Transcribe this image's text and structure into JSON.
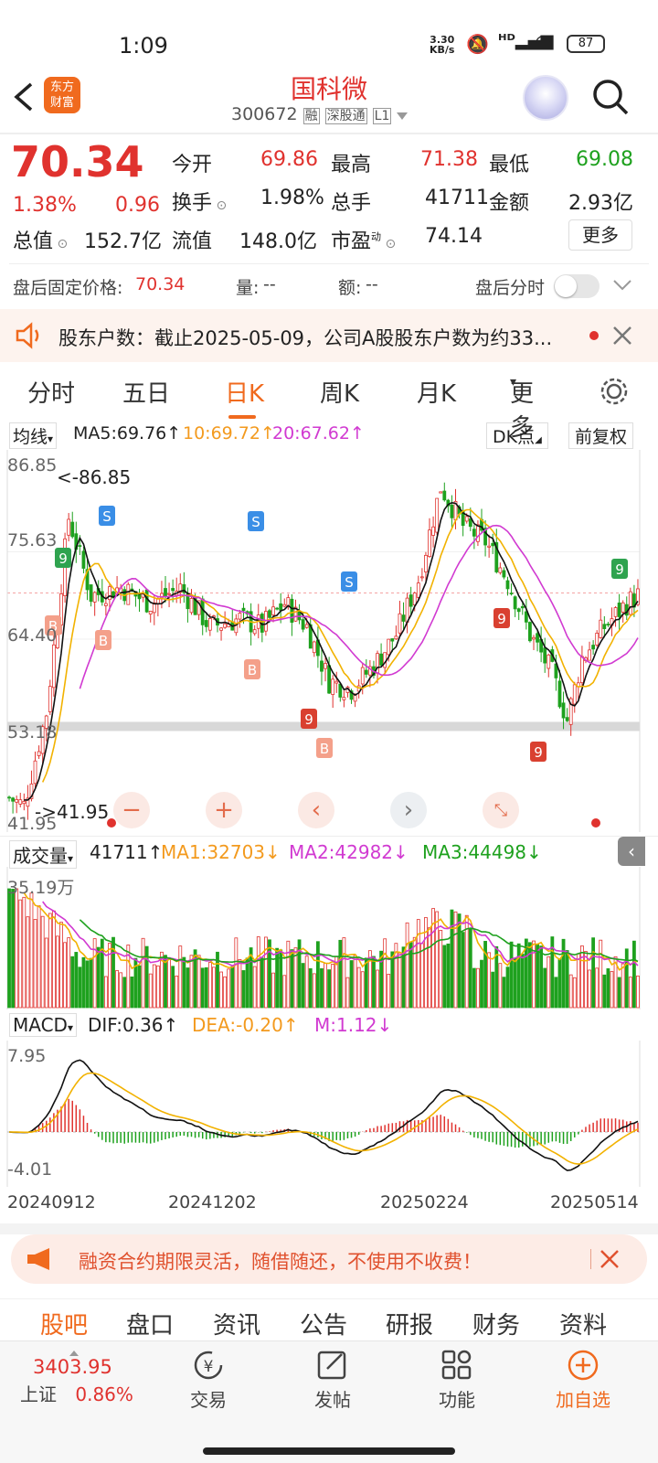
{
  "status": {
    "time": "1:09",
    "net_speed_top": "3.30",
    "net_speed_bottom": "KB/s",
    "battery": "87"
  },
  "header": {
    "title": "国科微",
    "code": "300672",
    "tag1": "融",
    "tag2": "深股通",
    "tag3": "L1"
  },
  "quote": {
    "price": "70.34",
    "change_pct": "1.38%",
    "change": "0.96",
    "open_label": "今开",
    "open": "69.86",
    "high_label": "最高",
    "high": "71.38",
    "low_label": "最低",
    "low": "69.08",
    "turnover_label": "换手",
    "turnover": "1.98%",
    "volume_label": "总手",
    "volume": "41711",
    "amount_label": "金额",
    "amount": "2.93亿",
    "mcap_label": "总值",
    "mcap": "152.7亿",
    "float_label": "流值",
    "float": "148.0亿",
    "pe_label": "市盈",
    "pe_sup": "动",
    "pe": "74.14",
    "more": "更多"
  },
  "after_hours": {
    "price_label": "盘后固定价格:",
    "price": "70.34",
    "vol_label": "量:",
    "vol": "--",
    "amt_label": "额:",
    "amt": "--",
    "timeshare_label": "盘后分时"
  },
  "notice": {
    "text": "股东户数：截止2025-05-09，公司A股股东户数为约33..."
  },
  "period_tabs": [
    "分时",
    "五日",
    "日K",
    "周K",
    "月K",
    "更多"
  ],
  "active_tab": "日K",
  "kline": {
    "ma_selector": "均线",
    "ma5": "MA5:69.76",
    "ma10": "10:69.72",
    "ma20": "20:67.62",
    "dk": "DK点",
    "adjust": "前复权",
    "y_labels": [
      "86.85",
      "75.63",
      "64.40",
      "53.18",
      "41.95"
    ],
    "max_label": "<-86.85",
    "min_label": "->41.95"
  },
  "volume_panel": {
    "selector": "成交量",
    "vol": "41711",
    "ma1": "MA1:32703",
    "ma2": "MA2:42982",
    "ma3": "MA3:44498",
    "y_top": "35.19万"
  },
  "macd_panel": {
    "selector": "MACD",
    "dif": "DIF:0.36",
    "dea": "DEA:-0.20",
    "m": "M:1.12",
    "y_top": "7.95",
    "y_bottom": "-4.01"
  },
  "x_dates": [
    "20240912",
    "20241202",
    "20250224",
    "20250514"
  ],
  "promo": {
    "text": "融资合约期限灵活，随借随还，不使用不收费！"
  },
  "bottom_tabs": [
    "股吧",
    "盘口",
    "资讯",
    "公告",
    "研报",
    "财务",
    "资料"
  ],
  "bottom_nav": {
    "index_value": "3403.95",
    "index_name": "上证",
    "index_pct": "0.86%",
    "trade": "交易",
    "post": "发帖",
    "func": "功能",
    "watch": "加自选"
  },
  "colors": {
    "up": "#e0322e",
    "down": "#1ea11e",
    "accent": "#f06a1e"
  }
}
